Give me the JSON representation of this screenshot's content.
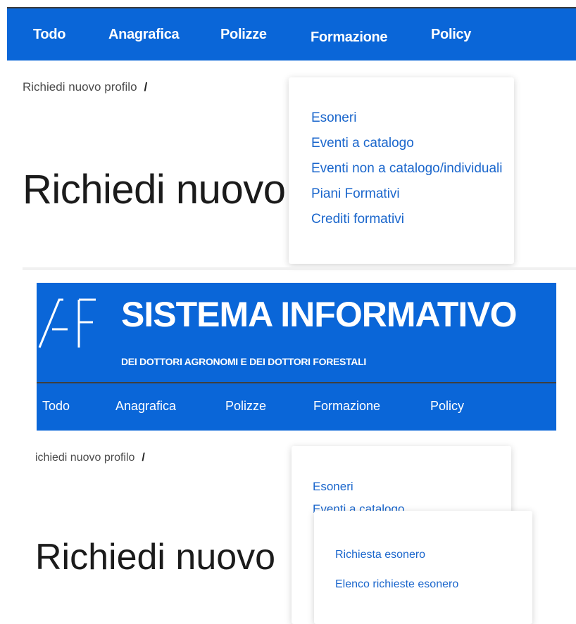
{
  "colors": {
    "brand_blue": "#0a66d8",
    "link_blue": "#1a66cc",
    "title_text": "#1b1b1b"
  },
  "top": {
    "nav": [
      "Todo",
      "Anagrafica",
      "Polizze",
      "Formazione",
      "Policy"
    ],
    "breadcrumb": "Richiedi nuovo profilo",
    "breadcrumb_separator": "/",
    "title": "Richiedi nuovo",
    "dropdown": [
      "Esoneri",
      "Eventi a catalogo",
      "Eventi non a catalogo/individuali",
      "Piani Formativi",
      "Crediti formativi"
    ]
  },
  "bottom": {
    "site_title": "SISTEMA INFORMATIVO",
    "site_subtitle": "DEI DOTTORI AGRONOMI E DEI DOTTORI FORESTALI",
    "logo_letters": "AF",
    "nav": [
      "Todo",
      "Anagrafica",
      "Polizze",
      "Formazione",
      "Policy"
    ],
    "breadcrumb": "ichiedi nuovo profilo",
    "breadcrumb_separator": "/",
    "title": "Richiedi nuovo",
    "dropdown": [
      "Esoneri",
      "Eventi a catalogo"
    ],
    "submenu": [
      "Richiesta esonero",
      "Elenco richieste esonero"
    ]
  }
}
